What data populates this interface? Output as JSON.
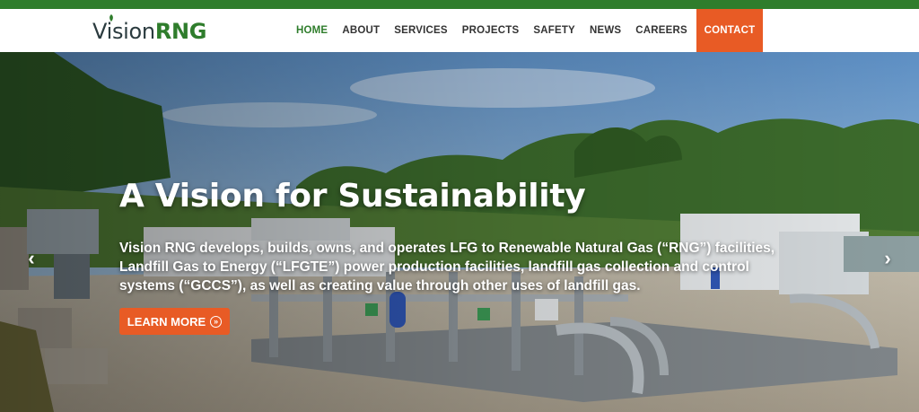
{
  "brand": {
    "logo_part1": "Vision",
    "logo_part2": "RNG",
    "top_strip_color": "#2f7d2c",
    "accent_color": "#e85b25"
  },
  "nav": {
    "items": [
      {
        "label": "HOME",
        "active": true
      },
      {
        "label": "ABOUT"
      },
      {
        "label": "SERVICES"
      },
      {
        "label": "PROJECTS"
      },
      {
        "label": "SAFETY"
      },
      {
        "label": "NEWS"
      },
      {
        "label": "CAREERS"
      }
    ],
    "contact_label": "CONTACT"
  },
  "hero": {
    "title": "A Vision for Sustainability",
    "text": "Vision RNG develops, builds, owns, and operates LFG to Renewable Natural Gas (“RNG”) facilities, Landfill Gas to Energy (“LFGTE”) power production facilities, landfill gas collection and control systems (“GCCS”), as well as creating value through other uses of landfill gas.",
    "cta_label": "LEARN MORE",
    "cta_icon": "circle-chevron-right-icon",
    "prev_icon": "chevron-left-icon",
    "next_icon": "chevron-right-icon",
    "prev_glyph": "‹",
    "next_glyph": "›",
    "cta_glyph": "»"
  }
}
